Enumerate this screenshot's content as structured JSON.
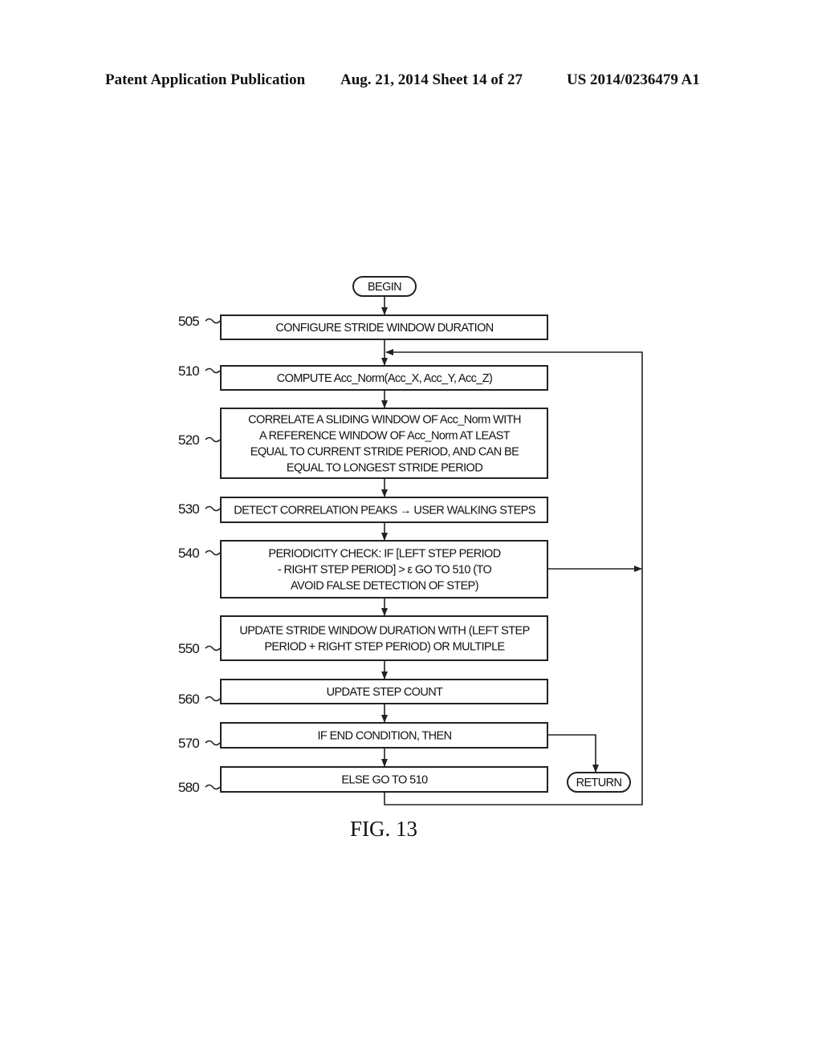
{
  "header": {
    "left": "Patent Application Publication",
    "middle": "Aug. 21, 2014  Sheet 14 of 27",
    "right": "US 2014/0236479 A1"
  },
  "flowchart": {
    "begin": "BEGIN",
    "return": "RETURN",
    "steps": [
      {
        "ref": "505",
        "lines": [
          "CONFIGURE STRIDE WINDOW DURATION"
        ]
      },
      {
        "ref": "510",
        "lines": [
          "COMPUTE Acc_Norm(Acc_X, Acc_Y, Acc_Z)"
        ]
      },
      {
        "ref": "520",
        "lines": [
          "CORRELATE A SLIDING WINDOW OF Acc_Norm WITH",
          "A REFERENCE WINDOW OF Acc_Norm AT LEAST",
          "EQUAL TO CURRENT STRIDE PERIOD, AND CAN BE",
          "EQUAL TO LONGEST STRIDE PERIOD"
        ]
      },
      {
        "ref": "530",
        "lines": [
          "DETECT CORRELATION PEAKS → USER WALKING STEPS"
        ]
      },
      {
        "ref": "540",
        "lines": [
          "PERIODICITY CHECK: IF [LEFT STEP PERIOD",
          "- RIGHT STEP PERIOD] > ε GO TO 510 (TO",
          "AVOID FALSE DETECTION OF STEP)"
        ]
      },
      {
        "ref": "550",
        "lines": [
          "UPDATE STRIDE WINDOW DURATION WITH (LEFT STEP",
          "PERIOD + RIGHT STEP PERIOD) OR MULTIPLE"
        ]
      },
      {
        "ref": "560",
        "lines": [
          "UPDATE STEP COUNT"
        ]
      },
      {
        "ref": "570",
        "lines": [
          "IF END CONDITION, THEN"
        ]
      },
      {
        "ref": "580",
        "lines": [
          "ELSE GO TO 510"
        ]
      }
    ],
    "figure_label": "FIG. 13"
  }
}
